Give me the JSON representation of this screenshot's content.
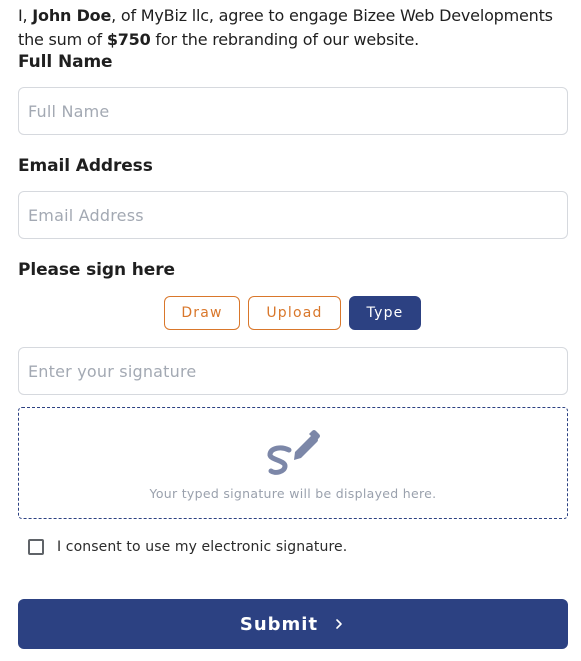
{
  "agreement": {
    "prefix": "I, ",
    "name": "John Doe",
    "middle": ", of MyBiz llc, agree to engage Bizee Web Developments the sum of ",
    "amount": "$750",
    "suffix": " for the rebranding of our website."
  },
  "full_name": {
    "label": "Full Name",
    "placeholder": "Full Name",
    "value": ""
  },
  "email": {
    "label": "Email Address",
    "placeholder": "Email Address",
    "value": ""
  },
  "signature": {
    "label": "Please sign here",
    "tabs": [
      {
        "label": "Draw",
        "active": false
      },
      {
        "label": "Upload",
        "active": false
      },
      {
        "label": "Type",
        "active": true
      }
    ],
    "input_placeholder": "Enter your signature",
    "input_value": "",
    "preview_icon": "signature-pen-icon",
    "preview_hint": "Your typed signature will be displayed here."
  },
  "consent": {
    "label": "I consent to use my electronic signature.",
    "checked": false
  },
  "submit": {
    "label": "Submit",
    "icon": "chevron-right-icon"
  },
  "colors": {
    "primary": "#2c4182",
    "accent_orange": "#d9772b",
    "placeholder": "#a3a9b3",
    "border": "#d6d9de"
  }
}
